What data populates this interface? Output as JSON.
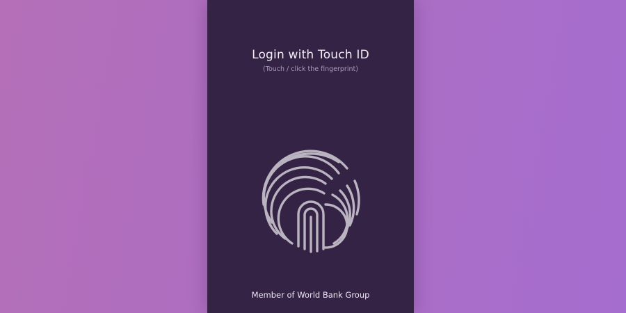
{
  "login": {
    "title": "Login with Touch ID",
    "subtitle": "(Touch / click the fingerprint)",
    "footer": "Member of World Bank Group"
  },
  "icons": {
    "fingerprint": "fingerprint-icon"
  },
  "colors": {
    "background_start": "#b46fb8",
    "background_end": "#a56dcf",
    "panel": "#352346",
    "fingerprint": "#b9b4c0",
    "title_text": "#f2eef6",
    "subtitle_text": "#a99bb8"
  }
}
